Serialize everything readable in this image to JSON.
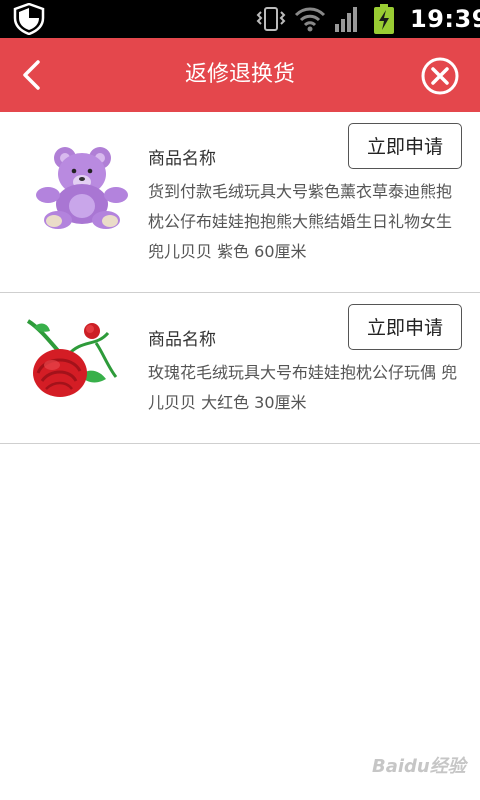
{
  "status_bar": {
    "time": "19:39",
    "icons": [
      "shield-icon",
      "vibrate-icon",
      "wifi-icon",
      "signal-icon",
      "battery-charging-icon"
    ]
  },
  "header": {
    "title": "返修退换货",
    "back_icon": "chevron-left-icon",
    "close_icon": "close-circle-icon",
    "background": "#e4474c"
  },
  "items": [
    {
      "image": "purple-teddy-bear",
      "name": "商品名称",
      "description": "货到付款毛绒玩具大号紫色薰衣草泰迪熊抱枕公仔布娃娃抱抱熊大熊结婚生日礼物女生 兜儿贝贝 紫色 60厘米",
      "button_label": "立即申请"
    },
    {
      "image": "red-rose-plush",
      "name": "商品名称",
      "description": "玫瑰花毛绒玩具大号布娃娃抱枕公仔玩偶 兜儿贝贝 大红色 30厘米",
      "button_label": "立即申请"
    }
  ],
  "watermark": "Baidu经验"
}
